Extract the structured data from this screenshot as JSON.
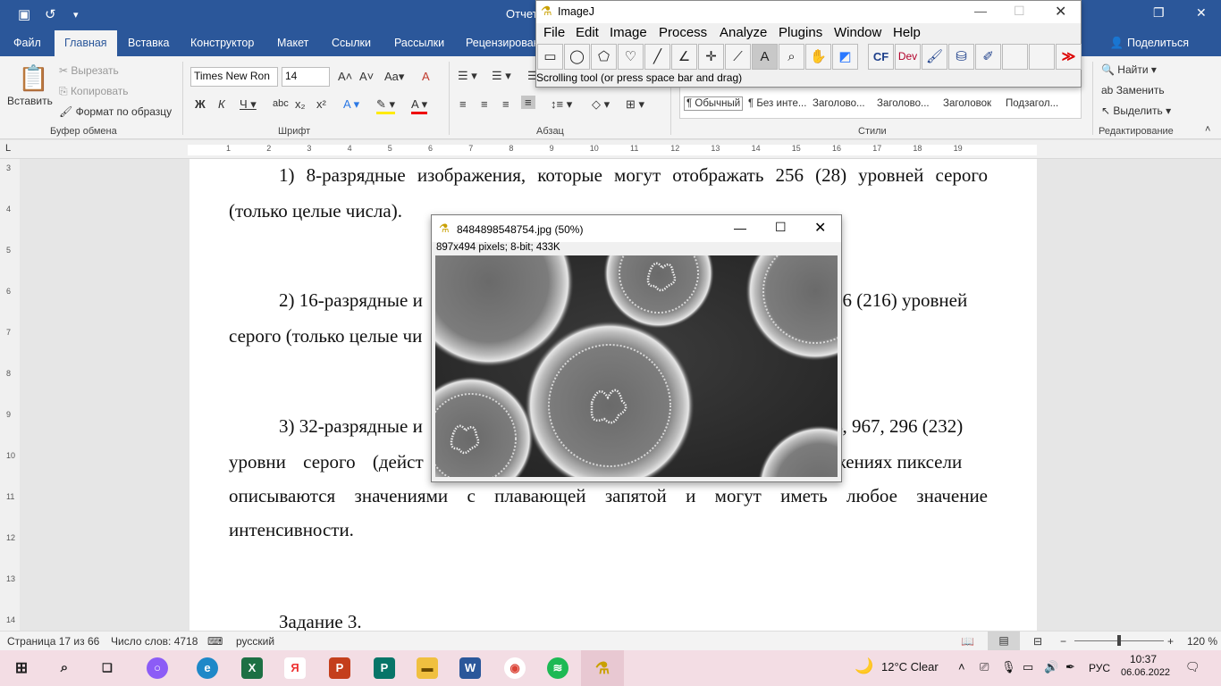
{
  "word": {
    "title_fragment": "Отчет",
    "tabs": [
      "Файл",
      "Главная",
      "Вставка",
      "Конструктор",
      "Макет",
      "Ссылки",
      "Рассылки",
      "Рецензирован"
    ],
    "share": "Поделиться",
    "clipboard": {
      "paste": "Вставить",
      "cut": "Вырезать",
      "copy": "Копировать",
      "format_painter": "Формат по образцу",
      "group": "Буфер обмена"
    },
    "font": {
      "name": "Times New Ron",
      "size": "14",
      "group": "Шрифт"
    },
    "paragraph_group": "Абзац",
    "styles": {
      "group": "Стили",
      "items": [
        "¶ Обычный",
        "¶ Без инте...",
        "Заголово...",
        "Заголово...",
        "Заголовок",
        "Подзагол..."
      ]
    },
    "editing": {
      "find": "Найти",
      "replace": "Заменить",
      "select": "Выделить",
      "group": "Редактирование"
    },
    "ruler_numbers": [
      "1",
      "2",
      "3",
      "4",
      "5",
      "6",
      "7",
      "8",
      "9",
      "10",
      "11",
      "12",
      "13",
      "14",
      "15",
      "16",
      "17",
      "18",
      "19"
    ],
    "vruler_numbers": [
      "3",
      "4",
      "5",
      "6",
      "7",
      "8",
      "9",
      "10",
      "11",
      "12",
      "13",
      "14"
    ],
    "document": {
      "p1_line1": "1) 8-разрядные изображения, которые могут отображать 256 (28) уровней серого",
      "p1_line2": "(только целые числа).",
      "p2_line1": "2) 16-разрядные и",
      "p2_line1_end": "36 (216) уровней",
      "p2_line2": "серого (только целые чи",
      "p3_line1": "3) 32-разрядные и",
      "p3_line1_end": "4, 967, 296 (232)",
      "p3_line2_start": "уровни серого (дейст",
      "p3_line2_end": "жениях пиксели",
      "p3_line3": "описываются значениями с плавающей запятой и могут иметь любое значение",
      "p3_line4": "интенсивности.",
      "task": "Задание 3."
    },
    "status": {
      "page": "Страница 17 из 66",
      "words": "Число слов: 4718",
      "lang": "русский",
      "zoom": "120 %"
    }
  },
  "imagej": {
    "title": "ImageJ",
    "menu": [
      "File",
      "Edit",
      "Image",
      "Process",
      "Analyze",
      "Plugins",
      "Window",
      "Help"
    ],
    "tools": [
      "rectangle-tool",
      "oval-tool",
      "polygon-tool",
      "freehand-tool",
      "line-tool",
      "angle-tool",
      "point-tool",
      "wand-tool",
      "text-tool",
      "magnifier-tool",
      "scrolling-tool",
      "color-picker-tool",
      "CF",
      "Dev",
      "brush-tool",
      "flood-fill-tool",
      "pencil-tool",
      "blank",
      "blank",
      "more-tools"
    ],
    "tool_labels": {
      "cf": "CF",
      "dev": "Dev"
    },
    "status": "Scrolling tool (or press space bar and drag)"
  },
  "image_window": {
    "title": "8484898548754.jpg (50%)",
    "info": "897x494 pixels; 8-bit; 433K"
  },
  "taskbar": {
    "weather": "12°C  Clear",
    "lang": "РУС",
    "time": "10:37",
    "date": "06.06.2022"
  }
}
